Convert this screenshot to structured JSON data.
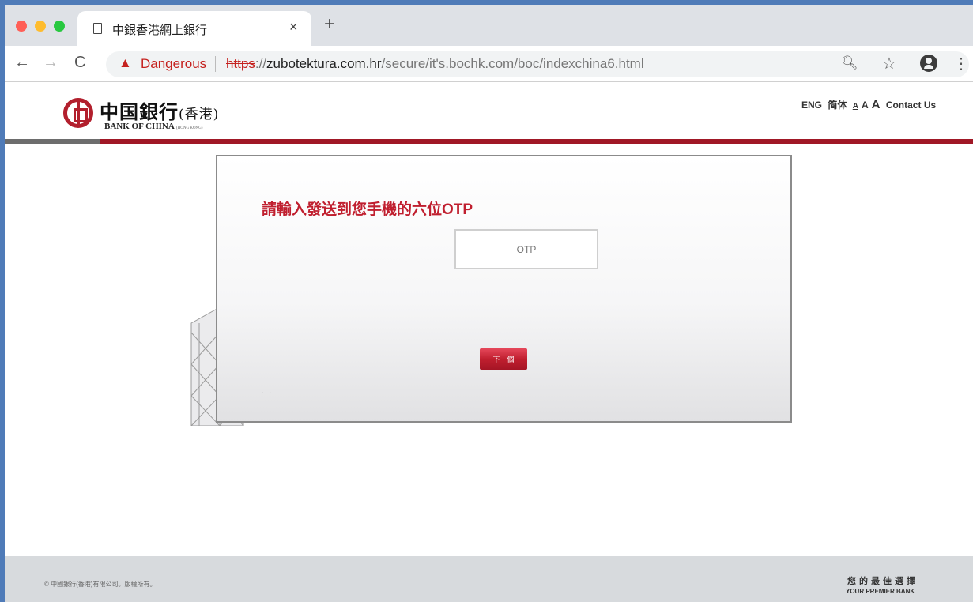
{
  "browser": {
    "tab_title": "中銀香港網上銀行",
    "tab_close": "×",
    "new_tab": "+",
    "back": "←",
    "forward": "→",
    "reload": "C",
    "security_label": "Dangerous",
    "url_scheme": "https",
    "url_sep": "://",
    "url_host": "zubotektura.com.hr",
    "url_path": "/secure/it's.bochk.com/boc/indexchina6.html"
  },
  "header": {
    "logo_cn": "中国銀行",
    "logo_cn_suffix": "(香港)",
    "logo_en": "BANK OF CHINA",
    "logo_en_suffix": "(HONG KONG)",
    "links": {
      "eng": "ENG",
      "simplified": "简体",
      "font_small": "A",
      "font_medium": "A",
      "font_large": "A",
      "contact": "Contact Us"
    }
  },
  "form": {
    "title": "請輸入發送到您手機的六位OTP",
    "otp_placeholder": "OTP",
    "next_button": "下一個",
    "dots": ". ."
  },
  "footer": {
    "copyright": "© 中國銀行(香港)有限公司。版權所有。",
    "slogan_cn": "您的最佳選擇",
    "slogan_en": "YOUR PREMIER BANK"
  },
  "colors": {
    "brand_red": "#c01f2f",
    "danger_red": "#c5221f",
    "divider_red": "#a01826",
    "frame_blue": "#4f7bb8"
  }
}
